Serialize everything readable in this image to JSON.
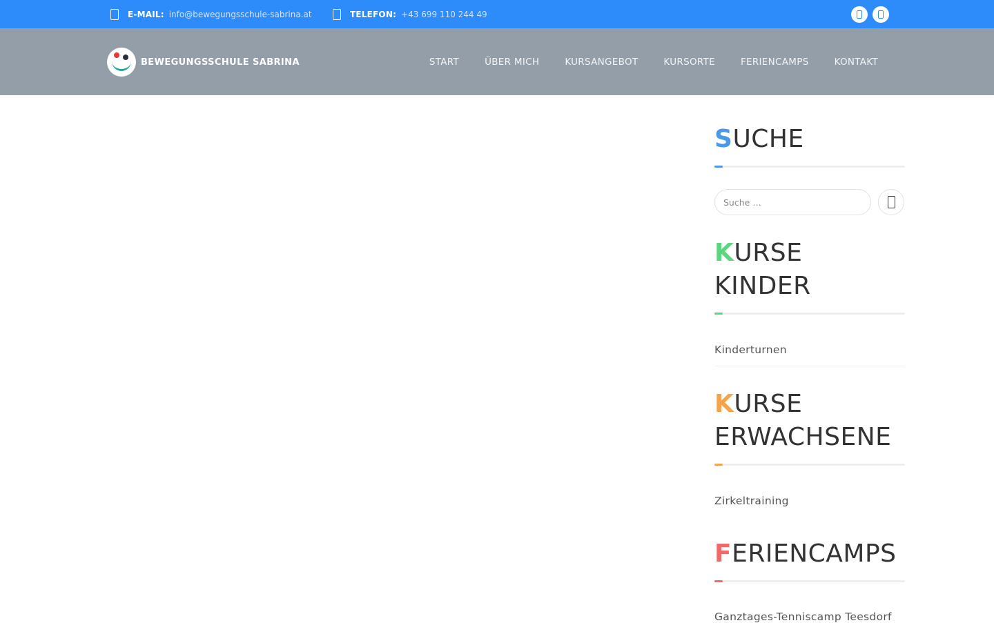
{
  "topbar": {
    "email_label": "E-MAIL:",
    "email_value": "info@bewegungsschule-sabrina.at",
    "phone_label": "TELEFON:",
    "phone_value": "+43 699 110 244 49",
    "email_icon": "envelope-icon",
    "phone_icon": "phone-icon",
    "social_icons": [
      "facebook-icon",
      "instagram-icon"
    ],
    "background": "#2d8cfa"
  },
  "header": {
    "brand": "BEWEGUNGSSCHULE SABRINA",
    "background": "#939ea9",
    "nav": [
      "START",
      "ÜBER MICH",
      "KURSANGEBOT",
      "KURSORTE",
      "FERIENCAMPS",
      "KONTAKT"
    ]
  },
  "sidebar": {
    "search": {
      "title_first": "S",
      "title_rest": "UCHE",
      "accent": "#4a98e8",
      "placeholder": "Suche …",
      "button_icon": "search-icon"
    },
    "kinder": {
      "title_first": "K",
      "title_rest": "URSE KINDER",
      "accent": "#5cd67f",
      "items": [
        "Kinderturnen"
      ]
    },
    "erwachsene": {
      "title_first": "K",
      "title_rest": "URSE ERWACHSENE",
      "accent": "#f4a54a",
      "items": [
        "Zirkeltraining"
      ]
    },
    "feriencamps": {
      "title_first": "F",
      "title_rest": "ERIENCAMPS",
      "accent": "#f06a6a",
      "items": [
        "Ganztages-Tenniscamp Teesdorf"
      ]
    }
  }
}
